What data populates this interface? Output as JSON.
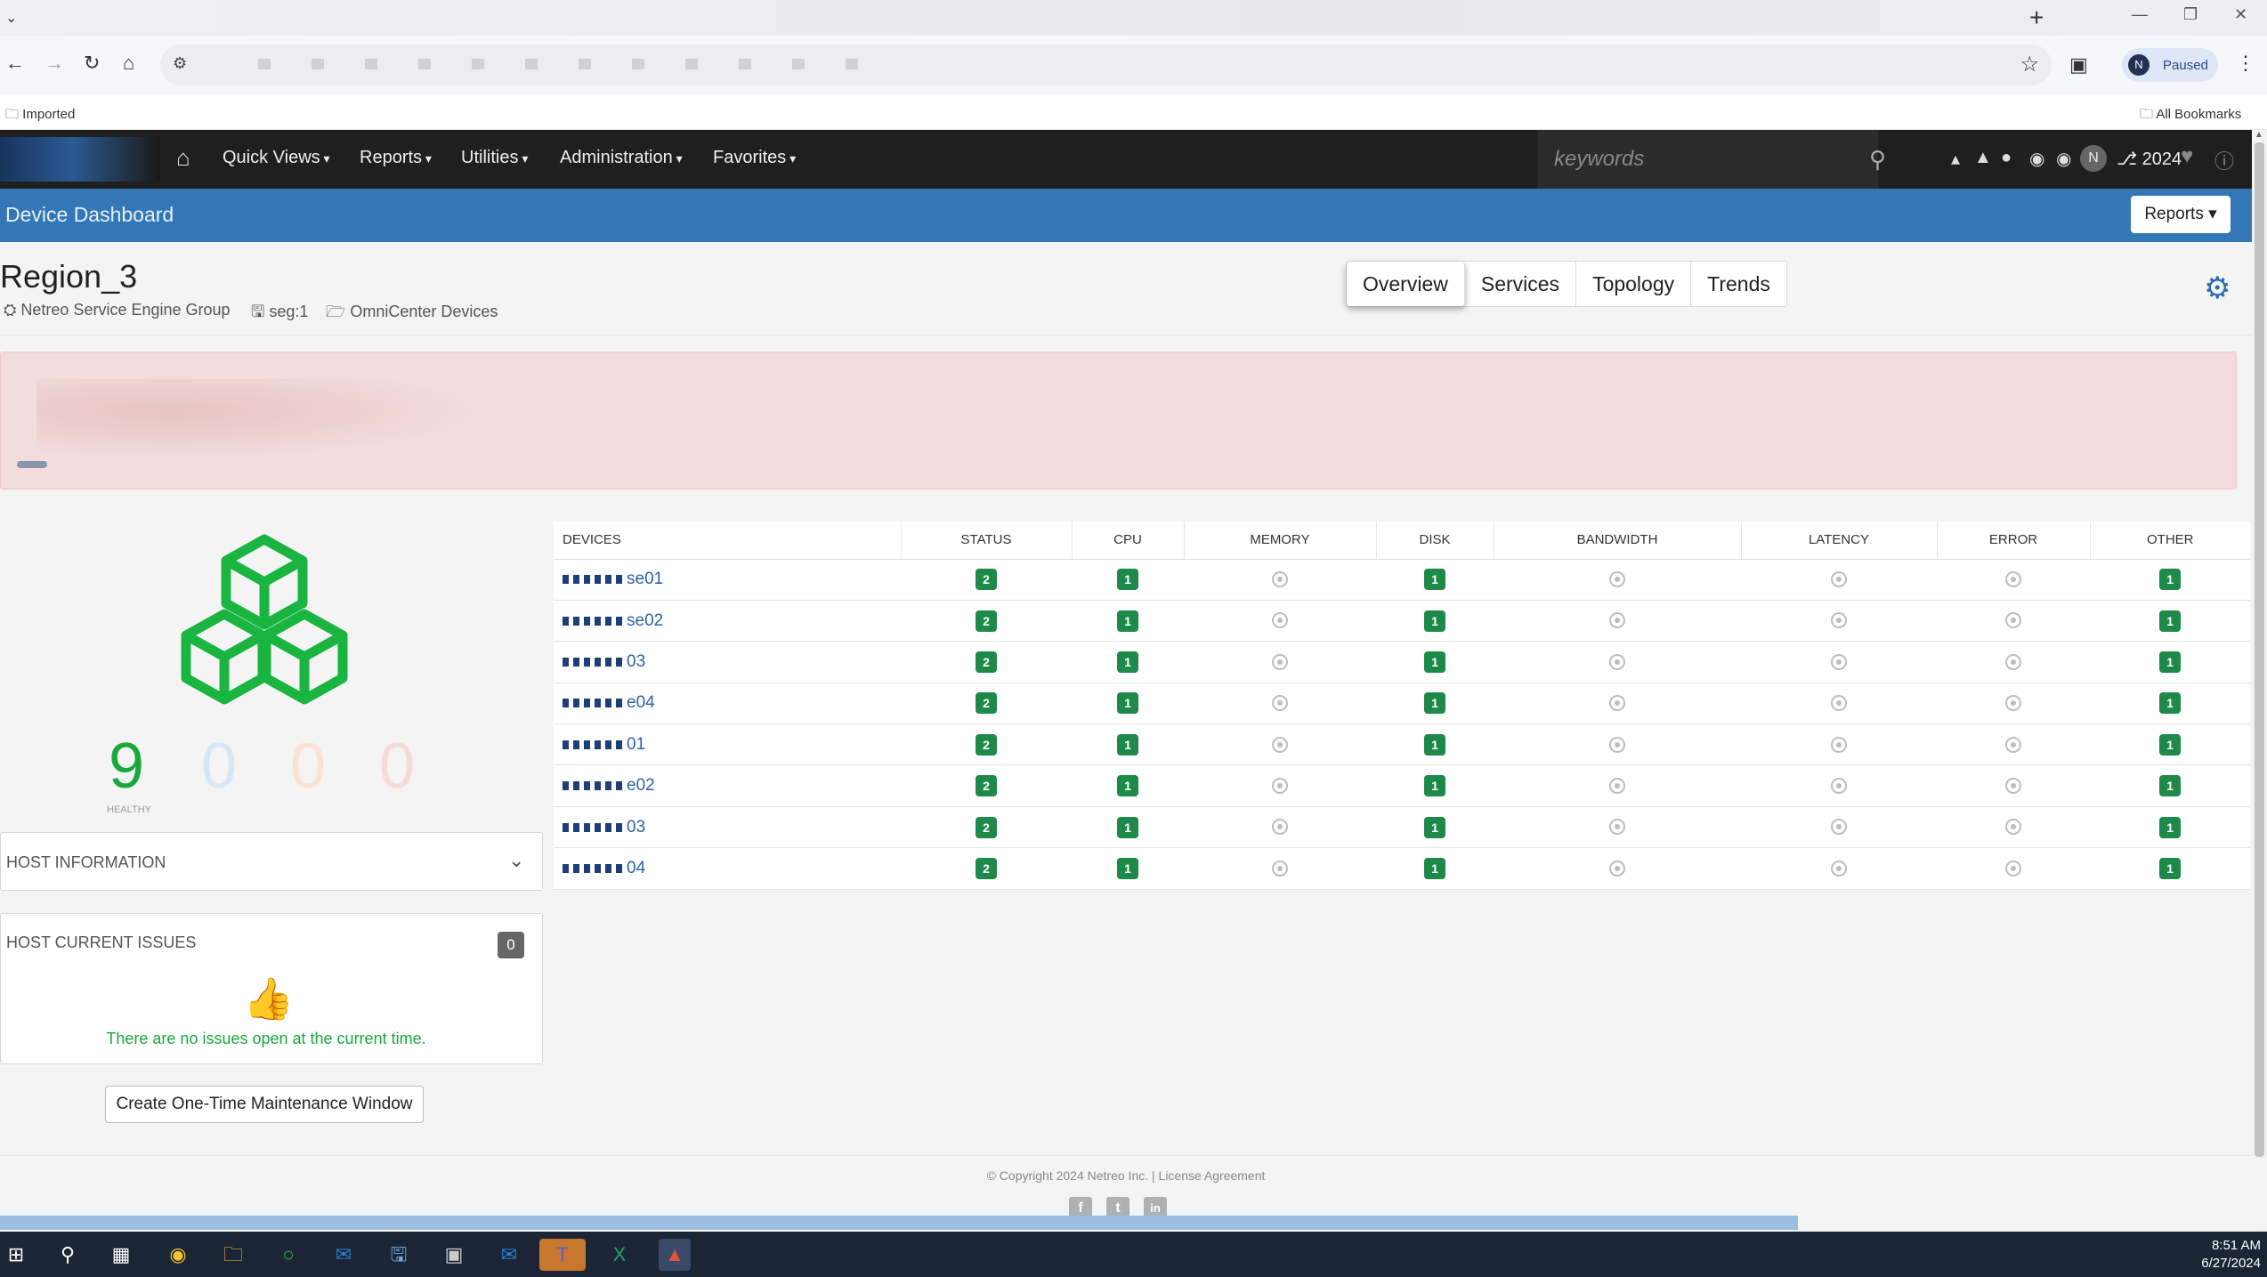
{
  "browser": {
    "profile_initial": "N",
    "profile_status": "Paused",
    "bookmark_left": "Imported",
    "bookmark_right": "All Bookmarks"
  },
  "navbar": {
    "menus": [
      "Quick Views",
      "Reports",
      "Utilities",
      "Administration",
      "Favorites"
    ],
    "search_placeholder": "keywords",
    "user_initial": "N",
    "year_label": "2024"
  },
  "dashboard": {
    "title": "Device Dashboard",
    "reports_label": "Reports"
  },
  "region": {
    "name": "Region_3",
    "group": "Netreo Service Engine Group",
    "seg": "seg:1",
    "category": "OmniCenter Devices"
  },
  "tabs": [
    "Overview",
    "Services",
    "Topology",
    "Trends"
  ],
  "health": {
    "healthy_count": "9",
    "healthy_label": "HEALTHY",
    "other_counts": [
      "0",
      "0",
      "0"
    ],
    "colors": {
      "healthy": "#19a93a",
      "info": "#3b8fd6",
      "warning": "#f0a05a",
      "critical": "#e05050"
    }
  },
  "panels": {
    "host_info_title": "HOST INFORMATION",
    "host_issues_title": "HOST CURRENT ISSUES",
    "host_issues_count": "0",
    "no_issues_text": "There are no issues open at the current time.",
    "maintenance_button": "Create One-Time Maintenance Window"
  },
  "table": {
    "headers": [
      "DEVICES",
      "STATUS",
      "CPU",
      "MEMORY",
      "DISK",
      "BANDWIDTH",
      "LATENCY",
      "ERROR",
      "OTHER"
    ],
    "rows": [
      {
        "name_suffix": "se01",
        "status": "2",
        "cpu": "1",
        "disk": "1",
        "other": "1"
      },
      {
        "name_suffix": "se02",
        "status": "2",
        "cpu": "1",
        "disk": "1",
        "other": "1"
      },
      {
        "name_suffix": "03",
        "status": "2",
        "cpu": "1",
        "disk": "1",
        "other": "1"
      },
      {
        "name_suffix": "e04",
        "status": "2",
        "cpu": "1",
        "disk": "1",
        "other": "1"
      },
      {
        "name_suffix": "01",
        "status": "2",
        "cpu": "1",
        "disk": "1",
        "other": "1"
      },
      {
        "name_suffix": "e02",
        "status": "2",
        "cpu": "1",
        "disk": "1",
        "other": "1"
      },
      {
        "name_suffix": "03",
        "status": "2",
        "cpu": "1",
        "disk": "1",
        "other": "1"
      },
      {
        "name_suffix": "04",
        "status": "2",
        "cpu": "1",
        "disk": "1",
        "other": "1"
      }
    ]
  },
  "footer": {
    "copyright": "© Copyright 2024 Netreo Inc. | License Agreement",
    "social": [
      "f",
      "t",
      "in"
    ]
  },
  "taskbar": {
    "time": "8:51 AM",
    "date": "6/27/2024"
  }
}
